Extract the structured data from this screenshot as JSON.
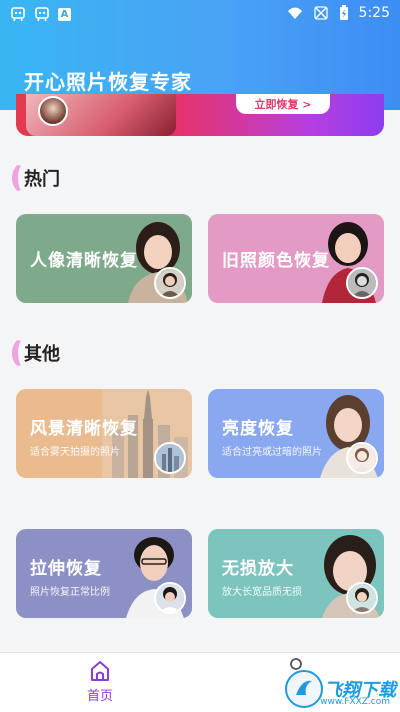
{
  "status_bar": {
    "time": "5:25",
    "left_icons": [
      "app-notification-icon",
      "app-notification-icon",
      "a-letter-icon"
    ],
    "right_icons": [
      "wifi-icon",
      "sim-icon",
      "battery-icon"
    ]
  },
  "header": {
    "title": "开心照片恢复专家"
  },
  "banner": {
    "button_label": "立即恢复 >"
  },
  "sections": {
    "hot": {
      "title": "热门"
    },
    "other": {
      "title": "其他"
    }
  },
  "cards": {
    "portrait": {
      "label": "人像清晰恢复"
    },
    "colorize": {
      "label": "旧照颜色恢复"
    },
    "landscape": {
      "label": "风景清晰恢复",
      "subtitle": "适合雾天拍摄的照片"
    },
    "brightness": {
      "label": "亮度恢复",
      "subtitle": "适合过亮或过暗的照片"
    },
    "stretch": {
      "label": "拉伸恢复",
      "subtitle": "照片恢复正常比例"
    },
    "enlarge": {
      "label": "无损放大",
      "subtitle": "放大长宽品质无损"
    }
  },
  "bottom_nav": {
    "home_label": "首页"
  },
  "watermark": {
    "text": "飞翔下载",
    "url": "www.FXXZ.com"
  },
  "colors": {
    "header_start": "#38b6f2",
    "header_end": "#3d8df3",
    "accent_purple": "#8a3bd8",
    "swoosh": "#f0a3e2"
  }
}
